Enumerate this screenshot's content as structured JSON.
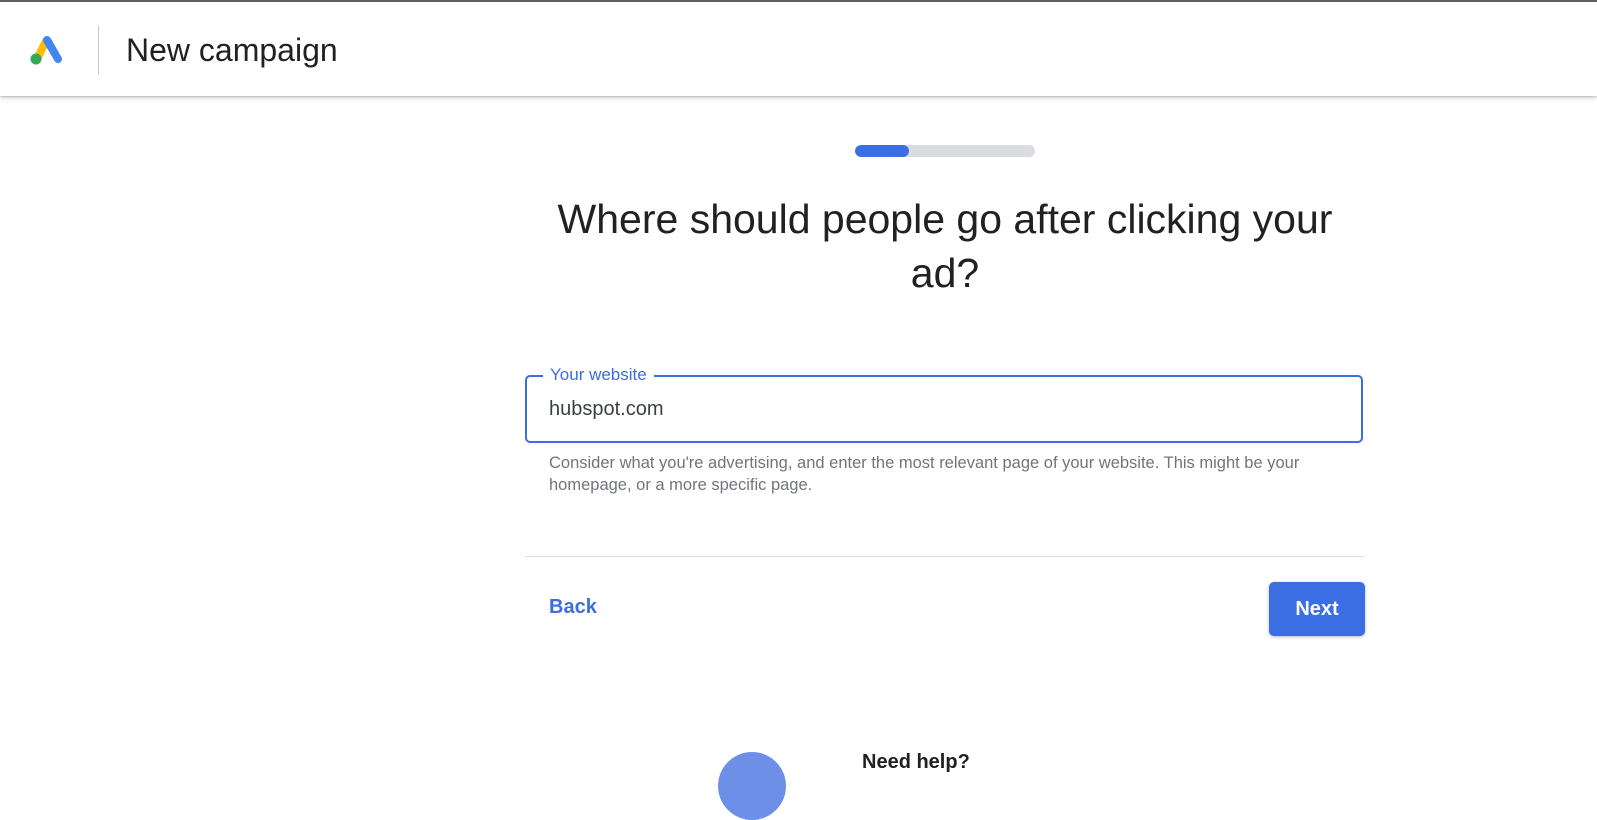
{
  "header": {
    "title": "New campaign",
    "logo_icon": "google-ads-logo-icon"
  },
  "progress": {
    "fraction": 0.3
  },
  "main": {
    "question": "Where should people go after clicking your ad?",
    "website_field": {
      "label": "Your website",
      "value": "hubspot.com",
      "helper": "Consider what you're advertising, and enter the most relevant page of your website. This might be your homepage, or a more specific page."
    },
    "back_label": "Back",
    "next_label": "Next"
  },
  "help": {
    "label": "Need help?"
  },
  "colors": {
    "accent": "#3b6ee3",
    "logo_blue": "#4285f4",
    "logo_yellow": "#fbbc04",
    "logo_green": "#34a853"
  }
}
